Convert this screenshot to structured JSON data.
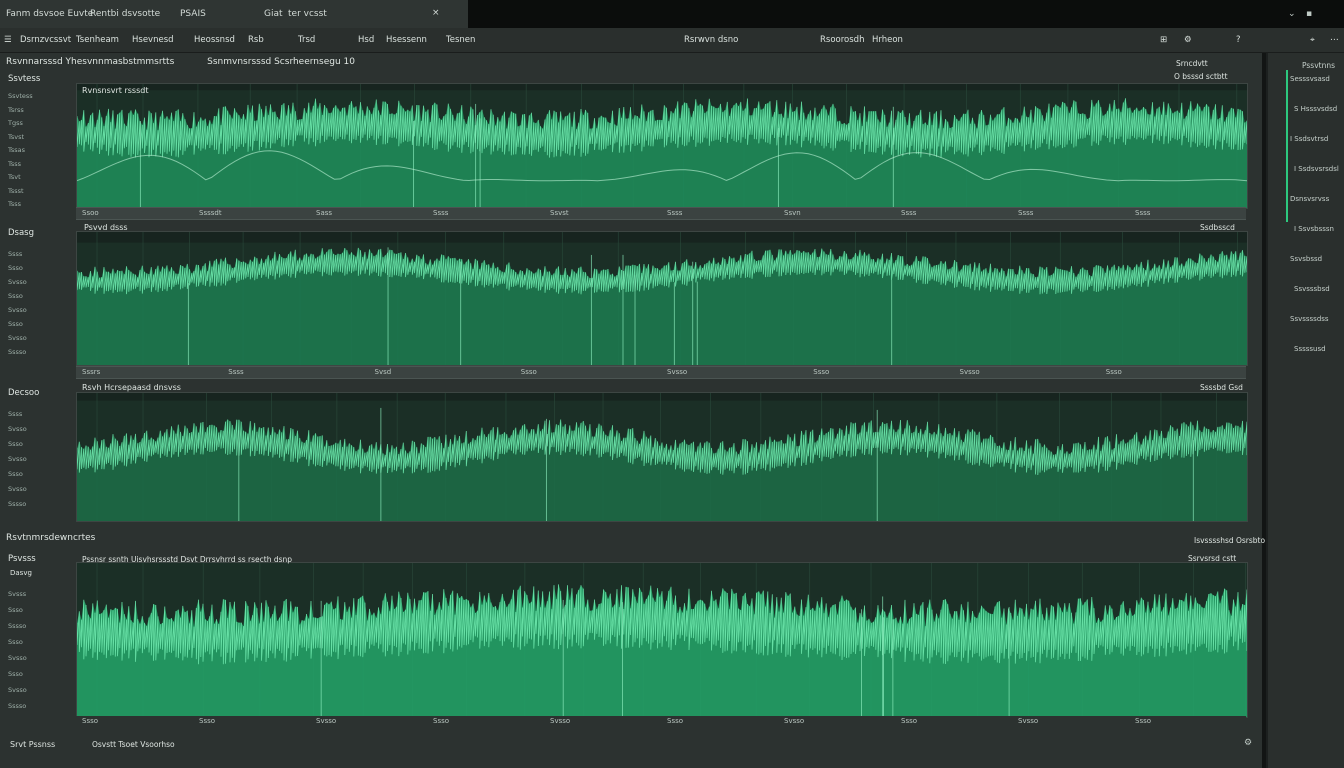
{
  "tabs": {
    "t1": "Fanm dsvsoe Euvte",
    "t2": "Rentbi dsvsotte",
    "t3": "PSAIS",
    "t4": "Giat",
    "t5": "ter vcsst"
  },
  "toolbar": {
    "m1": "Dsrnzvcssvt",
    "m2": "Tsenheam",
    "m3": "Hsevnesd",
    "m4": "Heossnsd",
    "m5": "Rsb",
    "m6": "Trsd",
    "m7": "Hsd",
    "m8": "Hsessenn",
    "m9": "Tesnen",
    "m10": "Rsrwvn dsno",
    "m11": "Rsoorosdh",
    "m12": "Hrheon"
  },
  "subheader": {
    "left": "Rsvnnarsssd Yhesvnnmasbstmmsrtts",
    "right": "Ssnmvnsrsssd Scsrheernsegu 10"
  },
  "panel1": {
    "top_right": "Srncdvtt",
    "legend": "O bsssd sctbtt",
    "title": "Rvnsnsvrt rsssdt",
    "side_label": "Ssvtess",
    "ticks": [
      "Ssvtess",
      "Tsrss",
      "Tgss",
      "Tsvst",
      "Tssas",
      "Tsss",
      "Tsvt",
      "Tssst",
      "Tsss"
    ]
  },
  "panel2": {
    "title": "Psvvd dsss",
    "badge": "Ssdbsscd",
    "side_label": "Dsasg",
    "ticks": [
      "Ssss",
      "Ssso",
      "Svsso",
      "Ssso",
      "Svsso",
      "Ssso",
      "Svsso",
      "Sssso"
    ]
  },
  "panel3": {
    "title": "Rsvh Hcrsepaasd dnsvss",
    "badge": "Ssssbd Gsd",
    "side_label": "Decsoo",
    "ticks": [
      "Ssss",
      "Svsso",
      "Ssso",
      "Svsso",
      "Ssso",
      "Svsso",
      "Sssso"
    ]
  },
  "panel4": {
    "section_title": "Rsvtnmrsdewncrtes",
    "section_right": "Isvsssshsd Osrsbto",
    "title": "Pssnsr ssnth Uisvhsrssstd Dsvt Drrsvhrrd ss rsecth dsnp",
    "badge": "Ssrvsrsd cstt",
    "side_label": "Dasvg",
    "side_top": "Psvsss",
    "ticks": [
      "Svsss",
      "Ssso",
      "Sssso",
      "Ssso",
      "Svsso",
      "Ssso",
      "Svsso",
      "Sssso"
    ]
  },
  "footer": {
    "left": "Srvt Pssnss",
    "mid": "Osvstt Tsoet Vsoorhso"
  },
  "rightpanel": {
    "title": "Pssvtnns",
    "items": [
      "Sesssvsasd",
      "S Hsssvsdsd",
      "I Ssdsvtrsd",
      "I Ssdsvsrsdsl",
      "Dsnsvsrvss",
      "I Ssvsbsssn",
      "Ssvsbssd",
      "Ssvsssbsd",
      "Ssvssssdss",
      "Sssssusd"
    ]
  },
  "strip_labels": {
    "s1": [
      "Ssoo",
      "Ssssdt",
      "Sass",
      "Ssss",
      "Ssvst",
      "Ssss",
      "Ssvn",
      "Ssss",
      "Ssss",
      "Ssss"
    ],
    "s2": [
      "Sssrs",
      "Ssss",
      "Svsd",
      "Ssso",
      "Svsso",
      "Ssso",
      "Svsso",
      "Ssso"
    ],
    "s4": [
      "Ssso",
      "Ssso",
      "Svsso",
      "Ssso",
      "Svsso",
      "Ssso",
      "Svsso",
      "Ssso",
      "Svsso",
      "Ssso"
    ]
  },
  "colors": {
    "accent": "#2dc97f",
    "plot_bg": "#1d3329",
    "fill": "#1f8f5c",
    "line": "#63e0a5"
  }
}
